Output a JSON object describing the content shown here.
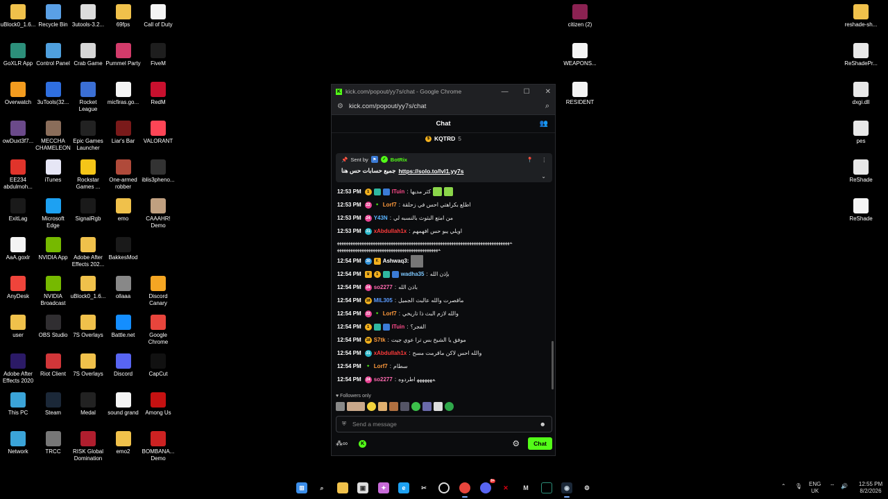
{
  "desktop": {
    "icons": [
      {
        "label": "uBlock0_1.6...",
        "icon": "folder-icon",
        "color": "#f0c14b"
      },
      {
        "label": "Recycle Bin",
        "icon": "recycle-bin-icon",
        "color": "#5aa0e6"
      },
      {
        "label": "3utools-3.2...",
        "icon": "installer-icon",
        "color": "#dcdcdc"
      },
      {
        "label": "69fps",
        "icon": "folder-icon",
        "color": "#f0c14b"
      },
      {
        "label": "Call of Duty",
        "icon": "document-icon",
        "color": "#f4f4f4"
      },
      {
        "label": "GoXLR App",
        "icon": "goxlr-icon",
        "color": "#2c8f7a"
      },
      {
        "label": "Control Panel",
        "icon": "control-panel-icon",
        "color": "#4fa0de"
      },
      {
        "label": "Crab Game",
        "icon": "crab-game-icon",
        "color": "#d6d6d6"
      },
      {
        "label": "Pummel Party",
        "icon": "pummel-party-icon",
        "color": "#d23b6a"
      },
      {
        "label": "FiveM",
        "icon": "fivem-icon",
        "color": "#1e1e1e"
      },
      {
        "label": "Overwatch",
        "icon": "overwatch-icon",
        "color": "#f39c1f"
      },
      {
        "label": "3uTools(32...",
        "icon": "3utools-icon",
        "color": "#2f6fe0"
      },
      {
        "label": "Rocket League",
        "icon": "rocket-league-icon",
        "color": "#3b6fd4"
      },
      {
        "label": "micfiras.go...",
        "icon": "document-icon",
        "color": "#f4f4f4"
      },
      {
        "label": "RedM",
        "icon": "redm-icon",
        "color": "#c8102e"
      },
      {
        "label": "owDuxt3f7...",
        "icon": "image-icon",
        "color": "#6b4a8a"
      },
      {
        "label": "MECCHA CHAMELEON",
        "icon": "meccha-icon",
        "color": "#8a6d5a"
      },
      {
        "label": "Epic Games Launcher",
        "icon": "epic-games-icon",
        "color": "#222222"
      },
      {
        "label": "Liar's Bar",
        "icon": "liars-bar-icon",
        "color": "#7a1a1a"
      },
      {
        "label": "VALORANT",
        "icon": "valorant-icon",
        "color": "#fd4556"
      },
      {
        "label": "EE234 abdulmoh...",
        "icon": "pdf-icon",
        "color": "#e0342b"
      },
      {
        "label": "iTunes",
        "icon": "itunes-icon",
        "color": "#e6e6f5"
      },
      {
        "label": "Rockstar Games ...",
        "icon": "rockstar-icon",
        "color": "#f5c518"
      },
      {
        "label": "One-armed robber",
        "icon": "one-armed-robber-icon",
        "color": "#b04a3a"
      },
      {
        "label": "iblis3pheno...",
        "icon": "image-icon",
        "color": "#333333"
      },
      {
        "label": "ExitLag",
        "icon": "exitlag-icon",
        "color": "#1a1a1a"
      },
      {
        "label": "Microsoft Edge",
        "icon": "edge-icon",
        "color": "#1da1f2"
      },
      {
        "label": "SignalRgb",
        "icon": "signalrgb-icon",
        "color": "#1a1a1a"
      },
      {
        "label": "emo",
        "icon": "folder-icon",
        "color": "#f0c14b"
      },
      {
        "label": "CAAAHR! Demo",
        "icon": "caaahr-icon",
        "color": "#c0a080"
      },
      {
        "label": "AaA.goxlr",
        "icon": "document-icon",
        "color": "#f4f4f4"
      },
      {
        "label": "NVIDIA App",
        "icon": "nvidia-icon",
        "color": "#76b900"
      },
      {
        "label": "Adobe After Effects 202...",
        "icon": "folder-icon",
        "color": "#f0c14b"
      },
      {
        "label": "BakkesMod",
        "icon": "bakkesmod-icon",
        "color": "#1a1a1a"
      },
      {
        "label": "",
        "icon": "",
        "color": ""
      },
      {
        "label": "AnyDesk",
        "icon": "anydesk-icon",
        "color": "#ef443b"
      },
      {
        "label": "NVIDIA Broadcast",
        "icon": "nvidia-broadcast-icon",
        "color": "#76b900"
      },
      {
        "label": "uBlock0_1.6...",
        "icon": "folder-icon",
        "color": "#f0c14b"
      },
      {
        "label": "ollaaa",
        "icon": "image-icon",
        "color": "#888888"
      },
      {
        "label": "Discord Canary",
        "icon": "discord-canary-icon",
        "color": "#f5a623"
      },
      {
        "label": "user",
        "icon": "folder-icon",
        "color": "#f0c14b"
      },
      {
        "label": "OBS Studio",
        "icon": "obs-icon",
        "color": "#302e31"
      },
      {
        "label": "7S Overlays",
        "icon": "folder-icon",
        "color": "#f0c14b"
      },
      {
        "label": "Battle.net",
        "icon": "battlenet-icon",
        "color": "#148eff"
      },
      {
        "label": "Google Chrome",
        "icon": "chrome-icon",
        "color": "#e8453c"
      },
      {
        "label": "Adobe After Effects 2020",
        "icon": "after-effects-icon",
        "color": "#2b1a66"
      },
      {
        "label": "Riot Client",
        "icon": "riot-client-icon",
        "color": "#d13639"
      },
      {
        "label": "7S Overlays",
        "icon": "folder-icon",
        "color": "#f0c14b"
      },
      {
        "label": "Discord",
        "icon": "discord-icon",
        "color": "#5865f2"
      },
      {
        "label": "CapCut",
        "icon": "capcut-icon",
        "color": "#111111"
      },
      {
        "label": "This PC",
        "icon": "this-pc-icon",
        "color": "#3ba4d8"
      },
      {
        "label": "Steam",
        "icon": "steam-icon",
        "color": "#1b2838"
      },
      {
        "label": "Medal",
        "icon": "medal-icon",
        "color": "#222222"
      },
      {
        "label": "sound grand",
        "icon": "document-icon",
        "color": "#f4f4f4"
      },
      {
        "label": "Among Us",
        "icon": "among-us-icon",
        "color": "#c51111"
      },
      {
        "label": "Network",
        "icon": "network-icon",
        "color": "#3ba4d8"
      },
      {
        "label": "TRCC",
        "icon": "trcc-icon",
        "color": "#777777"
      },
      {
        "label": "RISK Global Domination",
        "icon": "risk-icon",
        "color": "#b01e2e"
      },
      {
        "label": "emo2",
        "icon": "folder-icon",
        "color": "#f0c14b"
      },
      {
        "label": "BOMBANA... Demo",
        "icon": "bombana-icon",
        "color": "#cc2222"
      }
    ],
    "right_icons": [
      {
        "label": "citizen (2)",
        "icon": "winrar-icon",
        "color": "#8b2252"
      },
      {
        "label": "WEAPONS...",
        "icon": "document-icon",
        "color": "#f4f4f4"
      },
      {
        "label": "RESIDENT",
        "icon": "document-icon",
        "color": "#f4f4f4"
      },
      {
        "label": "reshade-sh...",
        "icon": "folder-icon",
        "color": "#f0c14b"
      },
      {
        "label": "ReShadePr...",
        "icon": "settings-file-icon",
        "color": "#e8e8e8"
      },
      {
        "label": "dxgi.dll",
        "icon": "settings-file-icon",
        "color": "#e8e8e8"
      },
      {
        "label": "pes",
        "icon": "settings-file-icon",
        "color": "#e8e8e8"
      },
      {
        "label": "ReShade",
        "icon": "settings-file-icon",
        "color": "#e8e8e8"
      },
      {
        "label": "ReShade",
        "icon": "document-icon",
        "color": "#f4f4f4"
      }
    ]
  },
  "window": {
    "title": "kick.com/popout/yy7s/chat - Google Chrome",
    "url": "kick.com/popout/yy7s/chat",
    "chat_title": "Chat",
    "top_gifter": {
      "name": "KQTRD",
      "count": "5"
    },
    "pinned": {
      "sent_by_label": "Sent by",
      "bot_name": "BotRix",
      "message": "جميع حسابات حس هنا",
      "link": "https://solo.to/lvl1.yy7s"
    },
    "followers_only": "Followers only",
    "send_placeholder": "Send a message",
    "chat_button": "Chat",
    "accent": "#53fc18"
  },
  "messages": [
    {
      "time": "12:53 PM",
      "badges": [
        "coin-1",
        "sub",
        "sub2"
      ],
      "user": "ITuin",
      "color": "#ff4b8a",
      "text": "كثر مديها",
      "emotes": 2
    },
    {
      "time": "12:53 PM",
      "badges": [
        "level-22",
        "star"
      ],
      "user": "Lorf7",
      "color": "#ff9a3c",
      "text": "اطلع بكراهتي احس في زحلقة"
    },
    {
      "time": "12:53 PM",
      "badges": [
        "level-24"
      ],
      "user": "Y43N",
      "color": "#5ab4ff",
      "text": "من امتع البثوث بالنسبه لي"
    },
    {
      "time": "12:53 PM",
      "badges": [
        "level-31"
      ],
      "user": "xAbdullah1x",
      "color": "#ff3b3b",
      "text": "اويلي يبو حس افهمهم"
    },
    {
      "time": "",
      "multi": true,
      "line1": "ﻪﻬﻬﻬﻬﻬﻬﻬﻬﻬﻬﻬﻬﻬﻬﻬﻬﻬﻬﻬﻬﻬﻬﻬﻬﻬﻬﻬﻬﻬﻬﻬﻬﻬﻬﻬﻬﻬﻬﻬﻬﻬﻬﻬﻬﻬﻬﻬﻬﻬﻬﻬﻬﻬﻬﻬﻬﻬﻬﻬﻬﻬﻬﻬﻬﻬﻬﻬﻬﻬﻬﻬﻬﻬﻬﻬﻬﻬ",
      "line2": "ﻪﻬﻬﻬﻬﻬﻬﻬﻬﻬﻬﻬﻬﻬﻬﻬﻬﻬﻬﻬﻬﻬﻬﻬﻬﻬﻬﻬﻬﻬﻬﻬﻬﻬﻬﻬﻬﻬﻬﻬﻬﻬﻬﻬﻬﻬ"
    },
    {
      "time": "12:54 PM",
      "badges": [
        "level-30",
        "k"
      ],
      "user": "Ashwaq3:",
      "color": "#ffffff",
      "text": "",
      "avatar": true
    },
    {
      "time": "12:54 PM",
      "badges": [
        "crown",
        "coin-1",
        "sub",
        "sub2"
      ],
      "user": "wadha35",
      "color": "#7ec8ff",
      "text": "بإذن الله"
    },
    {
      "time": "12:54 PM",
      "badges": [
        "level-24"
      ],
      "user": "so2277",
      "color": "#ff6ab0",
      "text": "باذن الله"
    },
    {
      "time": "12:54 PM",
      "badges": [
        "level-18"
      ],
      "user": "MIL305",
      "color": "#5a9bff",
      "text": "ماقصرت والله عالبث الجميل"
    },
    {
      "time": "12:54 PM",
      "badges": [
        "level-22",
        "star"
      ],
      "user": "Lorf7",
      "color": "#ff9a3c",
      "text": "والله لازم البث ذا تاريخي"
    },
    {
      "time": "12:54 PM",
      "badges": [
        "coin-1",
        "sub",
        "sub2"
      ],
      "user": "ITuin",
      "color": "#ff4b8a",
      "text": "الفجر؟"
    },
    {
      "time": "12:54 PM",
      "badges": [
        "level-18"
      ],
      "user": "S7tk",
      "color": "#ff9a3c",
      "text": "موفق يا الشيخ بس ترا عوي جيت"
    },
    {
      "time": "12:54 PM",
      "badges": [
        "level-31"
      ],
      "user": "xAbdullah1x",
      "color": "#ff3b3b",
      "text": "والله احس لاكن ماقرمت مسح"
    },
    {
      "time": "12:54 PM",
      "badges": [
        "star"
      ],
      "user": "Lorf7",
      "color": "#ff9a3c",
      "text": "سطام"
    },
    {
      "time": "12:54 PM",
      "badges": [
        "level-24"
      ],
      "user": "so2277",
      "color": "#ff6ab0",
      "text": "ﻪﻬﻬﻬﻬﻬﻬ اطردوه"
    }
  ],
  "taskbar": {
    "language": "ENG",
    "region": "UK",
    "time": "12:55 PM",
    "date": "8/2/2026",
    "discord_badge": "9+"
  }
}
